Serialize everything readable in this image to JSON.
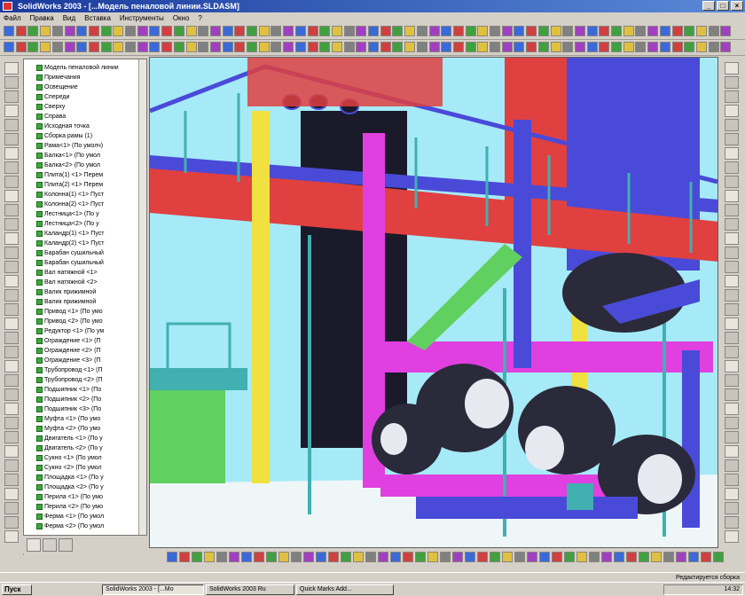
{
  "window": {
    "title": "SolidWorks 2003 - [...Модель пеналовой линии.SLDASM]",
    "controls": [
      "_",
      "□",
      "×"
    ]
  },
  "menu": [
    "Файл",
    "Правка",
    "Вид",
    "Вставка",
    "Инструменты",
    "Окно",
    "?"
  ],
  "tree": {
    "items": [
      "Модель пеналовой линии",
      "Примечания",
      "Освещение",
      "Спереди",
      "Сверху",
      "Справа",
      "Исходная точка",
      "Сборка рамы (1)",
      "Рама<1> (По умолч)",
      "Балка<1> (По умол",
      "Балка<2> (По умол",
      "Плита(1) <1> Перем",
      "Плита(2) <1> Перем",
      "Колонна(1) <1> Пуст",
      "Колонна(2) <1> Пуст",
      "Лестница<1> (По у",
      "Лестница<2> (По у",
      "Каландр(1) <1> Пуст",
      "Каландр(2) <1> Пуст",
      "Барабан сушильный",
      "Барабан сушильный",
      "Вал натяжной <1>",
      "Вал натяжной <2>",
      "Валик прижимной",
      "Валик прижимной",
      "Привод <1> (По умо",
      "Привод <2> (По умо",
      "Редуктор <1> (По ум",
      "Ограждение <1> (П",
      "Ограждение <2> (П",
      "Ограждение <3> (П",
      "Трубопровод <1> (П",
      "Трубопровод <2> (П",
      "Подшипник <1> (По",
      "Подшипник <2> (По",
      "Подшипник <3> (По",
      "Муфта <1> (По умо",
      "Муфта <2> (По умо",
      "Двигатель <1> (По у",
      "Двигатель <2> (По у",
      "Сукно <1> (По умол",
      "Сукно <2> (По умол",
      "Площадка <1> (По у",
      "Площадка <2> (По у",
      "Перила <1> (По умо",
      "Перила <2> (По умо",
      "Ферма <1> (По умол",
      "Ферма <2> (По умол"
    ]
  },
  "viewport": {
    "background": "#a6eaf7",
    "description_colors": {
      "magenta": "#e040e0",
      "blue": "#4a4ad8",
      "yellow": "#f0e040",
      "green": "#60d060",
      "red": "#e04040",
      "dark": "#1a1a2a",
      "teal": "#40b0b0",
      "pink": "#f070a0"
    }
  },
  "statusbar": {
    "right": "Редактируется сборка"
  },
  "taskbar": {
    "start": "Пуск",
    "tasks": [
      "SolidWorks 2003 - [...Мо",
      "SolidWorks 2003 Ru",
      "Quick Marks Add..."
    ],
    "clock": "14:32"
  }
}
